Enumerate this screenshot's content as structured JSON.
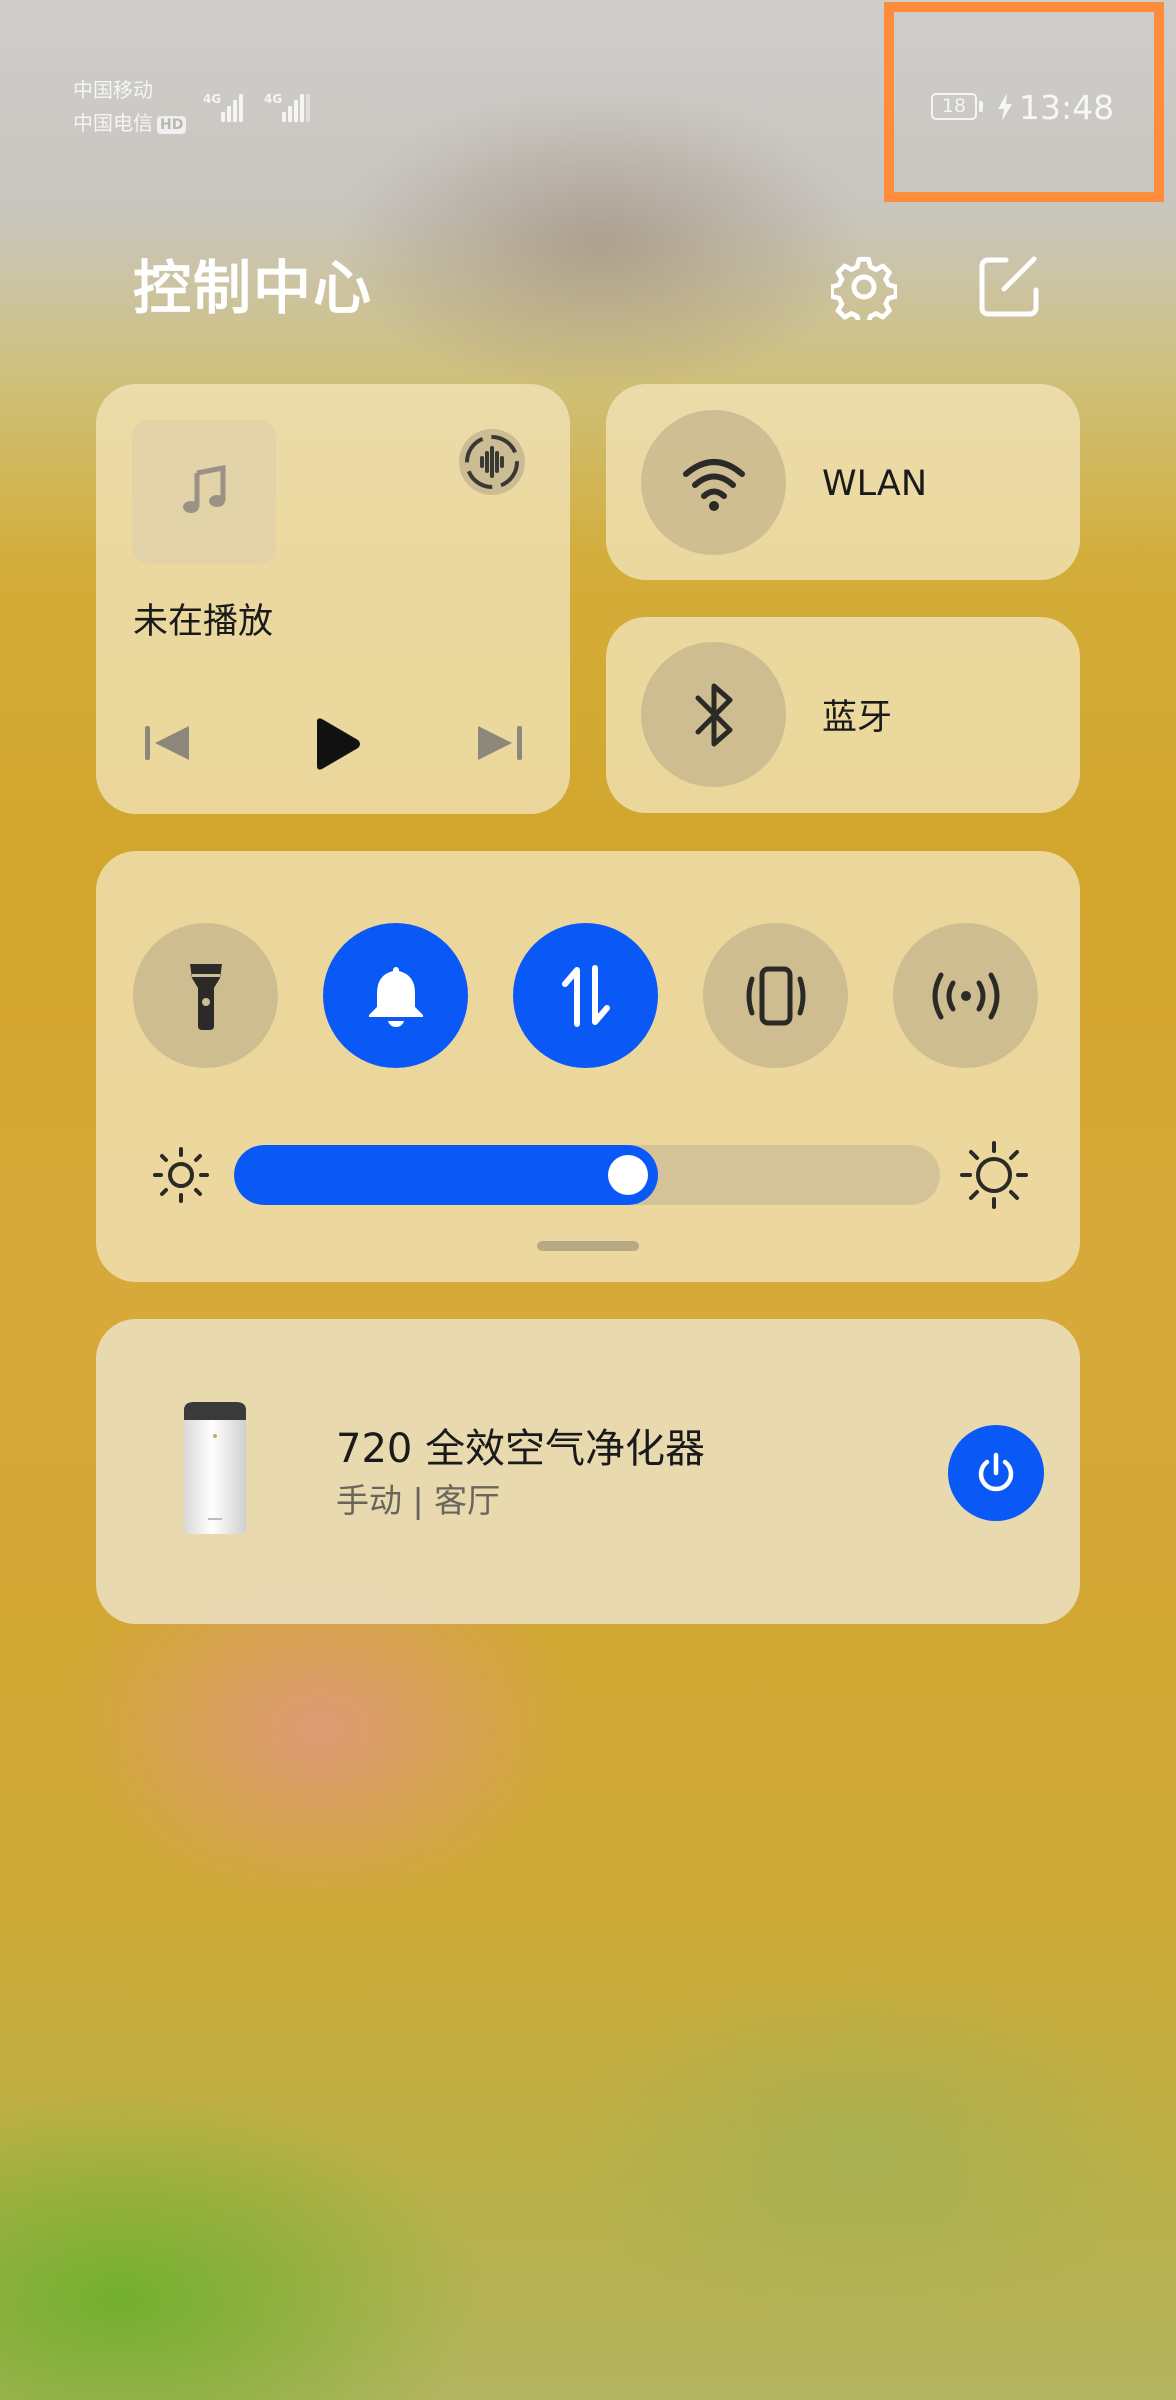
{
  "status_bar": {
    "carrier1": "中国移动",
    "carrier2": "中国电信",
    "hd_badge": "HD",
    "network1": "4G",
    "network2": "4G",
    "battery": "18",
    "time": "13:48"
  },
  "header": {
    "title": "控制中心",
    "settings_icon": "gear-icon",
    "edit_icon": "edit-icon"
  },
  "media": {
    "status": "未在播放",
    "controls": [
      "previous",
      "play",
      "next"
    ]
  },
  "connectivity": {
    "wlan_label": "WLAN",
    "bluetooth_label": "蓝牙"
  },
  "toggles": [
    {
      "icon": "flashlight-icon",
      "active": false
    },
    {
      "icon": "bell-icon",
      "active": true
    },
    {
      "icon": "mobile-data-icon",
      "active": true
    },
    {
      "icon": "vibrate-icon",
      "active": false
    },
    {
      "icon": "hotspot-icon",
      "active": false
    }
  ],
  "brightness": {
    "level": 0.6
  },
  "device": {
    "name": "720 全效空气净化器",
    "status": "手动 | 客厅"
  },
  "colors": {
    "accent": "#0a59f7",
    "highlight": "#ff8c3a"
  }
}
